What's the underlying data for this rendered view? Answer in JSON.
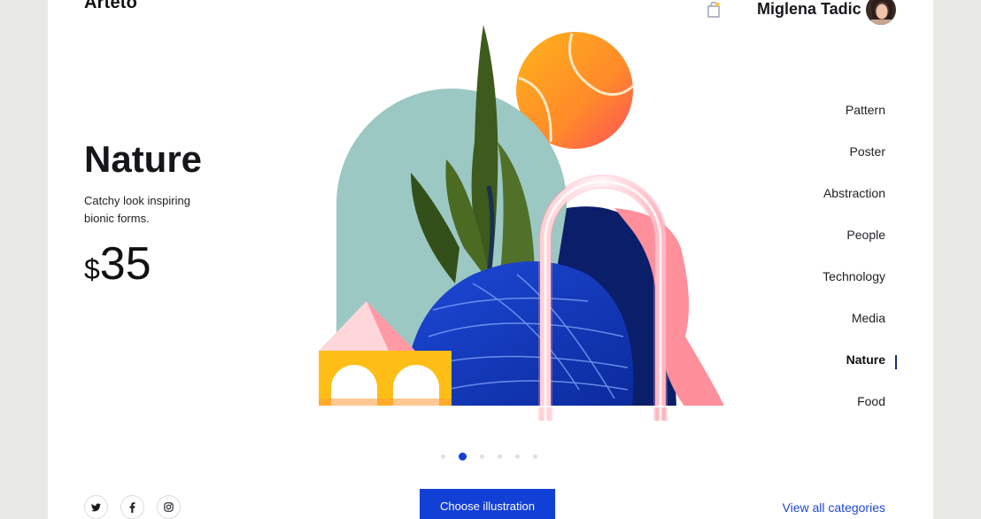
{
  "header": {
    "logo": "Arteto",
    "user_name": "Miglena Tadic",
    "cart_icon": "shopping-bag-icon"
  },
  "product": {
    "title": "Nature",
    "description": "Catchy look inspiring bionic forms.",
    "currency": "$",
    "price": "35"
  },
  "categories": {
    "items": [
      {
        "label": "Pattern"
      },
      {
        "label": "Poster"
      },
      {
        "label": "Abstraction"
      },
      {
        "label": "People"
      },
      {
        "label": "Technology"
      },
      {
        "label": "Media"
      },
      {
        "label": "Nature"
      },
      {
        "label": "Food"
      }
    ],
    "active": "Nature"
  },
  "carousel": {
    "total_slides": 6,
    "active_slide": 2
  },
  "social": [
    "twitter-icon",
    "facebook-icon",
    "instagram-icon"
  ],
  "actions": {
    "primary_label": "Choose illustration",
    "view_all_label": "View all categories"
  },
  "colors": {
    "accent": "#123fd6",
    "background": "#e9eae6"
  }
}
